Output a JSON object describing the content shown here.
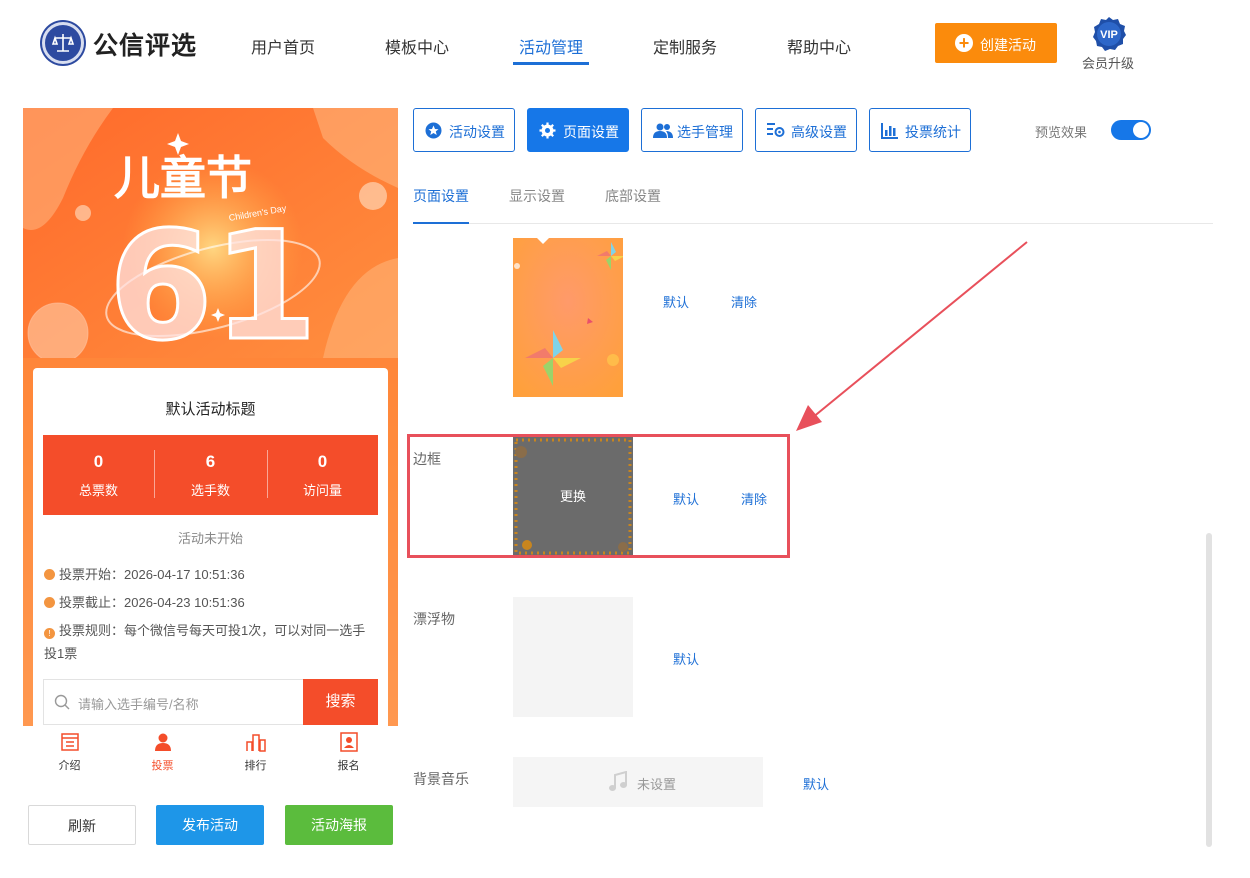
{
  "header": {
    "brand": "公信评选",
    "nav": [
      "用户首页",
      "模板中心",
      "活动管理",
      "定制服务",
      "帮助中心"
    ],
    "active_nav": "活动管理",
    "create_label": "创建活动",
    "vip_badge": "VIP",
    "vip_label": "会员升级",
    "colors": {
      "accent": "#1d6fd6",
      "create": "#fb8b0c"
    }
  },
  "preview": {
    "banner": {
      "title": "儿童节",
      "number": "61",
      "subtitle": "Children's Day"
    },
    "activity_title": "默认活动标题",
    "stats": [
      {
        "value": "0",
        "label": "总票数"
      },
      {
        "value": "6",
        "label": "选手数"
      },
      {
        "value": "0",
        "label": "访问量"
      }
    ],
    "status": "活动未开始",
    "vote_start": "投票开始：2026-04-17 10:51:36",
    "vote_end": "投票截止：2026-04-23 10:51:36",
    "vote_rule": "投票规则：每个微信号每天可投1次，可以对同一选手投1票",
    "search_placeholder": "请输入选手编号/名称",
    "search_button": "搜索",
    "tabs": [
      "介绍",
      "投票",
      "排行",
      "报名"
    ],
    "active_tab": "投票",
    "colors": {
      "stats": "#f44d2a"
    }
  },
  "bottom_buttons": {
    "refresh": "刷新",
    "publish": "发布活动",
    "poster": "活动海报"
  },
  "settings": {
    "top_tabs": [
      "活动设置",
      "页面设置",
      "选手管理",
      "高级设置",
      "投票统计"
    ],
    "active_top_tab": "页面设置",
    "preview_label": "预览效果",
    "preview_on": true,
    "sub_tabs": [
      "页面设置",
      "显示设置",
      "底部设置"
    ],
    "active_sub_tab": "页面设置",
    "background": {
      "default": "默认",
      "clear": "清除"
    },
    "border": {
      "label": "边框",
      "replace": "更换",
      "default": "默认",
      "clear": "清除"
    },
    "floating": {
      "label": "漂浮物",
      "default": "默认"
    },
    "music": {
      "label": "背景音乐",
      "status": "未设置",
      "default": "默认"
    }
  }
}
